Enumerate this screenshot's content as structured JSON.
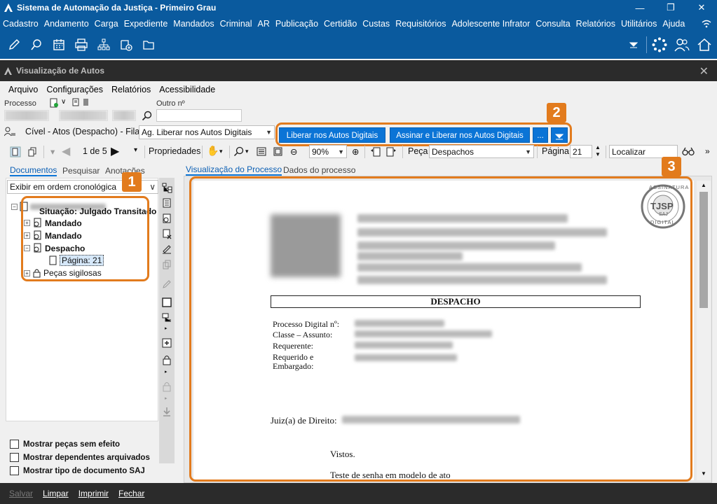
{
  "app": {
    "title": "Sistema de Automação da Justiça - Primeiro Grau",
    "menu": [
      "Cadastro",
      "Andamento",
      "Carga",
      "Expediente",
      "Mandados",
      "Criminal",
      "AR",
      "Publicação",
      "Certidão",
      "Custas",
      "Requisitórios",
      "Adolescente Infrator",
      "Consulta",
      "Relatórios",
      "Utilitários",
      "Ajuda"
    ]
  },
  "window": {
    "title": "Visualização de Autos",
    "menu": [
      "Arquivo",
      "Configurações",
      "Relatórios",
      "Acessibilidade"
    ]
  },
  "process": {
    "processo_label": "Processo",
    "outro_label": "Outro nº",
    "fila_text": "Cível - Atos (Despacho) - Fila:",
    "fila_value": "Ag. Liberar nos Autos Digitais",
    "btn_liberar": "Liberar nos Autos Digitais",
    "btn_assinar": "Assinar e Liberar nos Autos Digitais",
    "btn_more": "..."
  },
  "toolbar": {
    "page_of": "1 de 5",
    "propriedades": "Propriedades",
    "zoom": "90%",
    "peca_label": "Peça",
    "peca_value": "Despachos",
    "pagina_label": "Página",
    "pagina_value": "21",
    "localizar": "Localizar"
  },
  "left_tabs": [
    "Documentos",
    "Pesquisar",
    "Anotações"
  ],
  "order_select": "Exibir em ordem cronológica",
  "tree": {
    "situacao": "Situação: Julgado Transitado",
    "items": [
      "Mandado",
      "Mandado",
      "Despacho"
    ],
    "page": "Página: 21",
    "sigilosas": "Peças sigilosas"
  },
  "checks": [
    "Mostrar peças sem efeito",
    "Mostrar dependentes arquivados",
    "Mostrar tipo de documento SAJ"
  ],
  "doc_tabs": [
    "Visualização do Processo",
    "Dados do processo"
  ],
  "doc": {
    "stamp_top": "ASSINATURA",
    "stamp_center": "TJSP",
    "stamp_sub": "SAJ",
    "stamp_bottom": "DIGITAL",
    "heading": "DESPACHO",
    "fields": [
      "Processo Digital nº:",
      "Classe – Assunto:",
      "Requerente:",
      "Requerido e",
      "Embargado:"
    ],
    "juiz": "Juiz(a) de Direito:",
    "vistos": "Vistos.",
    "body": "Teste de senha em modelo de ato"
  },
  "callouts": [
    "1",
    "2",
    "3"
  ],
  "bottom": [
    "Salvar",
    "Limpar",
    "Imprimir",
    "Fechar"
  ],
  "colors": {
    "app_blue": "#0a5a9e",
    "button_blue": "#0b74d6",
    "callout_orange": "#e27b1d",
    "dark_bar": "#2b2b2b"
  }
}
